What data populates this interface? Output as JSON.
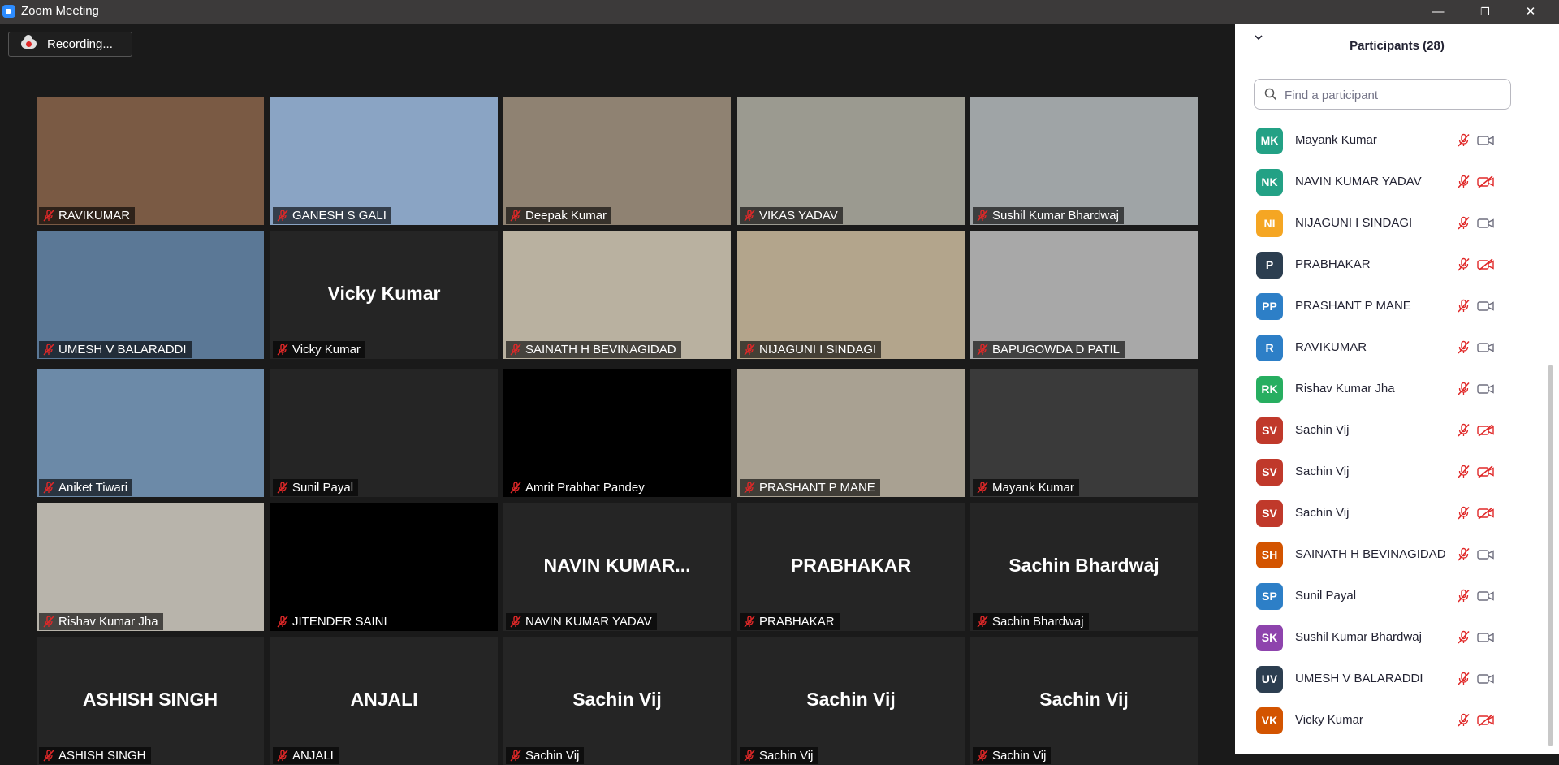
{
  "window": {
    "title": "Zoom Meeting",
    "minimize": "—",
    "restore": "❐",
    "close": "✕",
    "app_icon": "zoom-camera-icon"
  },
  "recording": {
    "label": "Recording...",
    "icon": "cloud-recording-icon"
  },
  "colors": {
    "muted": "#e02828",
    "text": "#232333"
  },
  "gallery": [
    {
      "name": "RAVIKUMAR",
      "has_video": true,
      "bg": "#7a5a44"
    },
    {
      "name": "GANESH S GALI",
      "has_video": true,
      "bg": "#8aa4c4"
    },
    {
      "name": "Deepak Kumar",
      "has_video": true,
      "bg": "#8f8272"
    },
    {
      "name": "VIKAS YADAV",
      "has_video": true,
      "bg": "#9b9a90"
    },
    {
      "name": "Sushil Kumar Bhardwaj",
      "has_video": true,
      "bg": "#9fa4a6"
    },
    {
      "name": "UMESH V BALARADDI",
      "has_video": true,
      "bg": "#5b7896"
    },
    {
      "name": "Vicky Kumar",
      "has_video": false,
      "big": "Vicky Kumar"
    },
    {
      "name": "SAINATH H BEVINAGIDAD",
      "has_video": true,
      "bg": "#b9b1a0"
    },
    {
      "name": "NIJAGUNI I SINDAGI",
      "has_video": true,
      "bg": "#b3a58c"
    },
    {
      "name": "BAPUGOWDA D PATIL",
      "has_video": true,
      "bg": "#a8a8a8"
    },
    {
      "name": "Aniket Tiwari",
      "has_video": true,
      "bg": "#6c8aa8"
    },
    {
      "name": "Sunil Payal",
      "has_video": false,
      "big": ""
    },
    {
      "name": "Amrit Prabhat Pandey",
      "has_video": true,
      "bg": "#000000"
    },
    {
      "name": "PRASHANT P MANE",
      "has_video": true,
      "bg": "#a9a192"
    },
    {
      "name": "Mayank Kumar",
      "has_video": true,
      "bg": "#3a3a3a"
    },
    {
      "name": "Rishav Kumar Jha",
      "has_video": true,
      "bg": "#b8b4ab"
    },
    {
      "name": "JITENDER SAINI",
      "has_video": true,
      "bg": "#000000"
    },
    {
      "name": "NAVIN KUMAR YADAV",
      "has_video": false,
      "big": "NAVIN  KUMAR..."
    },
    {
      "name": "PRABHAKAR",
      "has_video": false,
      "big": "PRABHAKAR"
    },
    {
      "name": "Sachin Bhardwaj",
      "has_video": false,
      "big": "Sachin Bhardwaj"
    },
    {
      "name": "ASHISH SINGH",
      "has_video": false,
      "big": "ASHISH SINGH"
    },
    {
      "name": "ANJALI",
      "has_video": false,
      "big": "ANJALI"
    },
    {
      "name": "Sachin Vij",
      "has_video": false,
      "big": "Sachin Vij"
    },
    {
      "name": "Sachin Vij",
      "has_video": false,
      "big": "Sachin Vij"
    },
    {
      "name": "Sachin Vij",
      "has_video": false,
      "big": "Sachin Vij"
    }
  ],
  "participants_panel": {
    "title": "Participants (28)",
    "search_placeholder": "Find a participant",
    "items": [
      {
        "initials": "MK",
        "name": "Mayank Kumar",
        "color": "#23a185",
        "cam_off": false
      },
      {
        "initials": "NK",
        "name": "NAVIN KUMAR YADAV",
        "color": "#23a185",
        "cam_off": true
      },
      {
        "initials": "NI",
        "name": "NIJAGUNI I SINDAGI",
        "color": "#f5a623",
        "cam_off": false
      },
      {
        "initials": "P",
        "name": "PRABHAKAR",
        "color": "#2c3e50",
        "cam_off": true
      },
      {
        "initials": "PP",
        "name": "PRASHANT P MANE",
        "color": "#2d7fc7",
        "cam_off": false
      },
      {
        "initials": "R",
        "name": "RAVIKUMAR",
        "color": "#2d7fc7",
        "cam_off": false
      },
      {
        "initials": "RK",
        "name": "Rishav Kumar Jha",
        "color": "#27ae60",
        "cam_off": false
      },
      {
        "initials": "SV",
        "name": "Sachin Vij",
        "color": "#c0392b",
        "cam_off": true
      },
      {
        "initials": "SV",
        "name": "Sachin Vij",
        "color": "#c0392b",
        "cam_off": true
      },
      {
        "initials": "SV",
        "name": "Sachin Vij",
        "color": "#c0392b",
        "cam_off": true
      },
      {
        "initials": "SH",
        "name": "SAINATH H BEVINAGIDAD",
        "color": "#d35400",
        "cam_off": false
      },
      {
        "initials": "SP",
        "name": "Sunil Payal",
        "color": "#2d7fc7",
        "cam_off": false
      },
      {
        "initials": "SK",
        "name": "Sushil Kumar Bhardwaj",
        "color": "#8e44ad",
        "cam_off": false
      },
      {
        "initials": "UV",
        "name": "UMESH V BALARADDI",
        "color": "#2c3e50",
        "cam_off": false
      },
      {
        "initials": "VK",
        "name": "Vicky Kumar",
        "color": "#d35400",
        "cam_off": true
      }
    ]
  }
}
